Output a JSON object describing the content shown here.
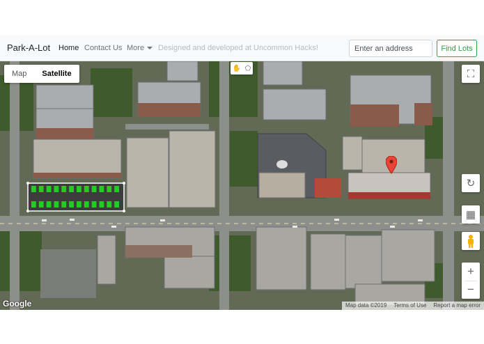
{
  "navbar": {
    "brand": "Park-A-Lot",
    "links": [
      {
        "label": "Home"
      },
      {
        "label": "Contact Us"
      },
      {
        "label": "More"
      }
    ],
    "credit_text": "Designed and developed at Uncommon Hacks!",
    "address_placeholder": "Enter an address",
    "find_label": "Find Lots"
  },
  "map": {
    "type_options": [
      "Map",
      "Satellite"
    ],
    "selected_type": "Satellite",
    "logo": "Google",
    "attribution": {
      "map_data": "Map data ©2019",
      "terms": "Terms of Use",
      "report": "Report a map error"
    },
    "controls": {
      "fullscreen_icon": "fullscreen-icon",
      "rotate_icon": "rotate-icon",
      "tilt_icon": "tilt-icon",
      "pegman_icon": "pegman-icon",
      "zoom_in": "+",
      "zoom_out": "−"
    },
    "drawing_tools": [
      "hand-icon",
      "polygon-icon"
    ]
  },
  "colors": {
    "success": "#28a745",
    "marker": "#ea4335",
    "lot_fill": "#3c3c3c",
    "spot_available": "#22cc22"
  },
  "parking_lot": {
    "spots_top_row": 12,
    "spots_bottom_row": 12
  }
}
